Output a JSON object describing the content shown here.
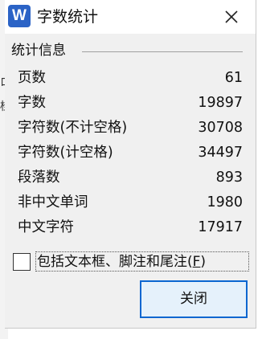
{
  "window": {
    "app_icon": "W",
    "title": "字数统计",
    "close_icon": "close-icon"
  },
  "background_window": {
    "glyphs": [
      "ロ",
      "桂"
    ]
  },
  "stats_group": {
    "title": "统计信息",
    "rows": [
      {
        "label": "页数",
        "value": "61"
      },
      {
        "label": "字数",
        "value": "19897"
      },
      {
        "label": "字符数(不计空格)",
        "value": "30708"
      },
      {
        "label": "字符数(计空格)",
        "value": "34497"
      },
      {
        "label": "段落数",
        "value": "893"
      },
      {
        "label": "非中文单词",
        "value": "1980"
      },
      {
        "label": "中文字符",
        "value": "17917"
      }
    ]
  },
  "include_option": {
    "label": "包括文本框、脚注和尾注(",
    "hotkey": "F",
    "label_suffix": ")",
    "checked": false
  },
  "buttons": {
    "close_label": "关闭"
  },
  "colors": {
    "app_icon": "#2b63c6",
    "dialog_bg": "#f0f0f0",
    "button_border": "#0a66d0",
    "button_bg": "#e5f1fb"
  }
}
